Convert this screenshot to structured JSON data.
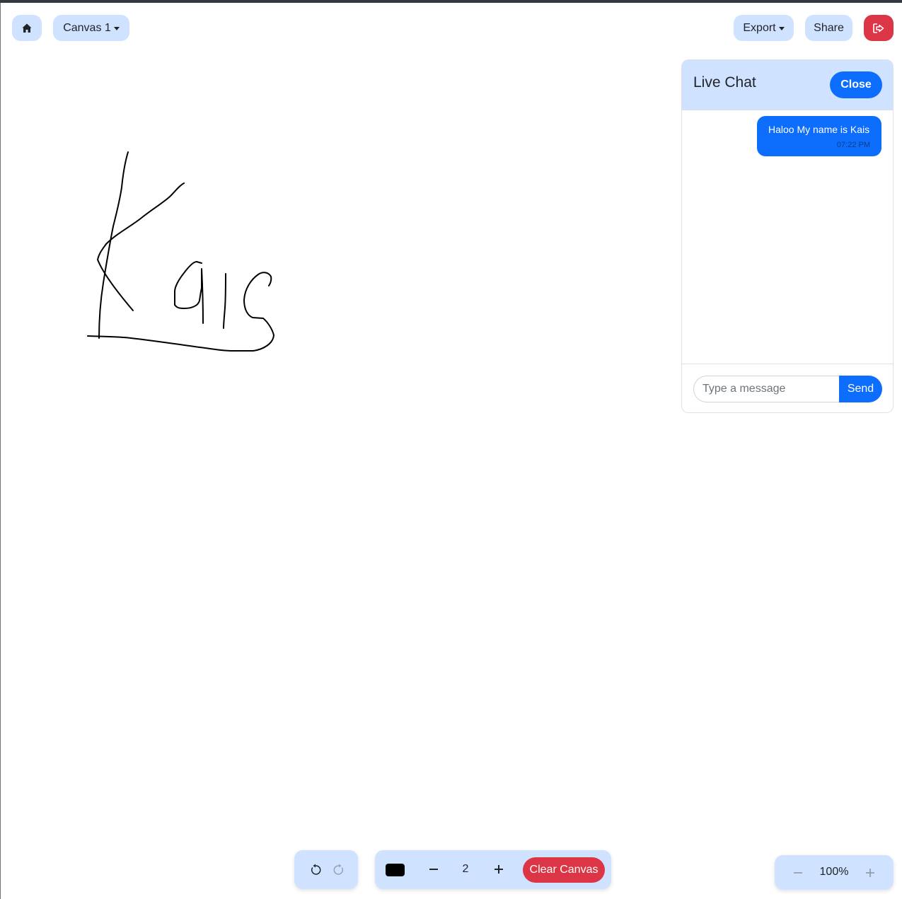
{
  "topbar": {
    "home_icon": "home-icon",
    "canvas_label": "Canvas 1",
    "export_label": "Export",
    "share_label": "Share",
    "logout_icon": "logout-icon"
  },
  "colors": {
    "accent": "#0d6efd",
    "pill_bg": "#cfe2ff",
    "danger": "#dc3545",
    "stroke": "#000000"
  },
  "chat": {
    "title": "Live Chat",
    "close_label": "Close",
    "messages": [
      {
        "text": "Haloo My name is Kais",
        "time": "07:22 PM"
      }
    ],
    "input_placeholder": "Type a message",
    "send_label": "Send"
  },
  "toolbar": {
    "undo_icon": "undo-icon",
    "redo_icon": "redo-icon",
    "brush_color": "#000000",
    "brush_size": "2",
    "clear_label": "Clear Canvas"
  },
  "zoom": {
    "value": "100%"
  }
}
